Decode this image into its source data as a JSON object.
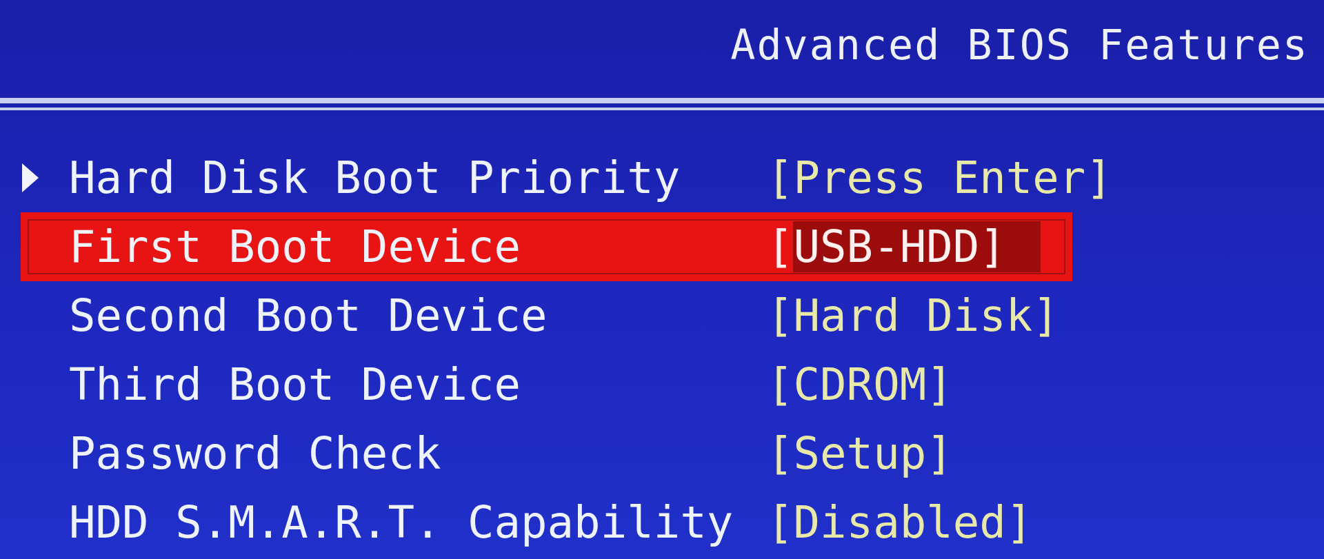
{
  "header": {
    "title": "Advanced BIOS Features"
  },
  "rows": [
    {
      "kind": "submenu",
      "label": "Hard Disk Boot Priority",
      "value": "[Press Enter]",
      "selected": false
    },
    {
      "kind": "option",
      "label": "First Boot Device",
      "value": "[USB-HDD]",
      "selected": true
    },
    {
      "kind": "option",
      "label": "Second Boot Device",
      "value": "[Hard Disk]",
      "selected": false
    },
    {
      "kind": "option",
      "label": "Third Boot Device",
      "value": "[CDROM]",
      "selected": false
    },
    {
      "kind": "option",
      "label": "Password Check",
      "value": "[Setup]",
      "selected": false
    },
    {
      "kind": "option",
      "label": "HDD S.M.A.R.T. Capability",
      "value": "[Disabled]",
      "selected": false
    }
  ]
}
